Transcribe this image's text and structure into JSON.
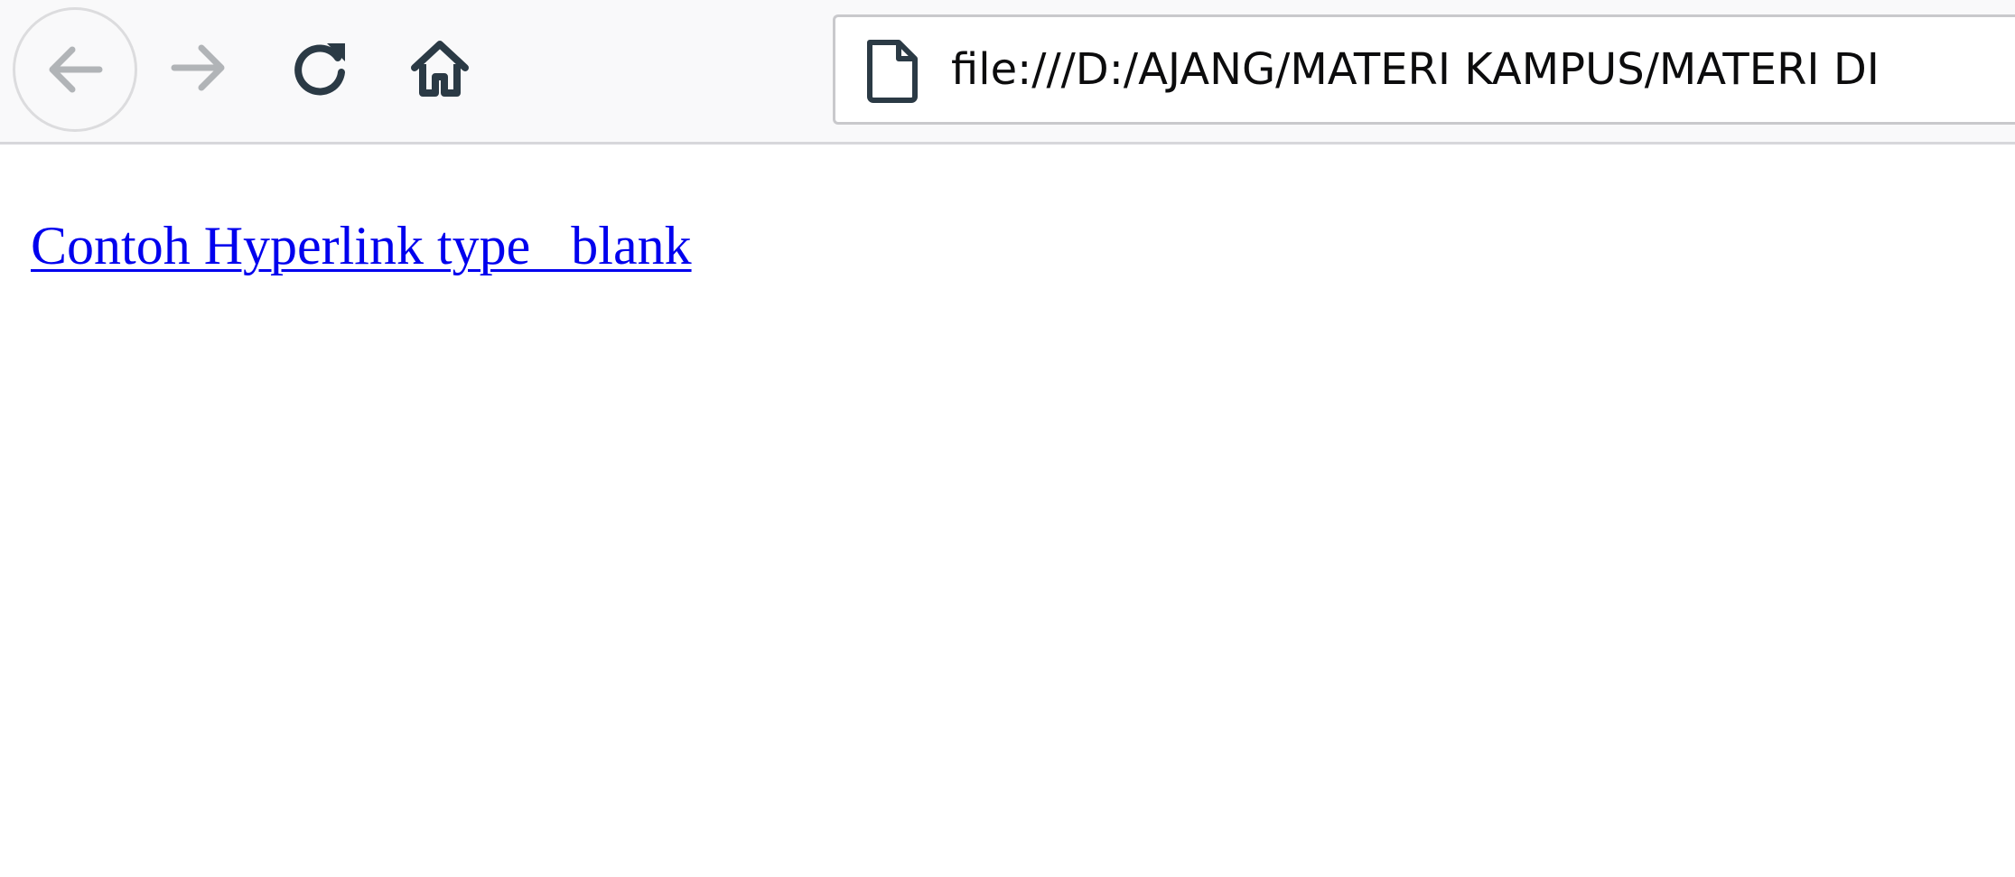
{
  "toolbar": {
    "back_icon": "back-arrow-icon",
    "forward_icon": "forward-arrow-icon",
    "reload_icon": "reload-icon",
    "home_icon": "home-icon",
    "url_icon": "page-file-icon",
    "url": "file:///D:/AJANG/MATERI KAMPUS/MATERI DI"
  },
  "page": {
    "link_text": "Contoh Hyperlink type   blank"
  },
  "colors": {
    "link": "#0000ee",
    "toolbar_bg": "#f9f9fa",
    "icon_active": "#2b3a45",
    "icon_disabled": "#b1b4b7"
  }
}
